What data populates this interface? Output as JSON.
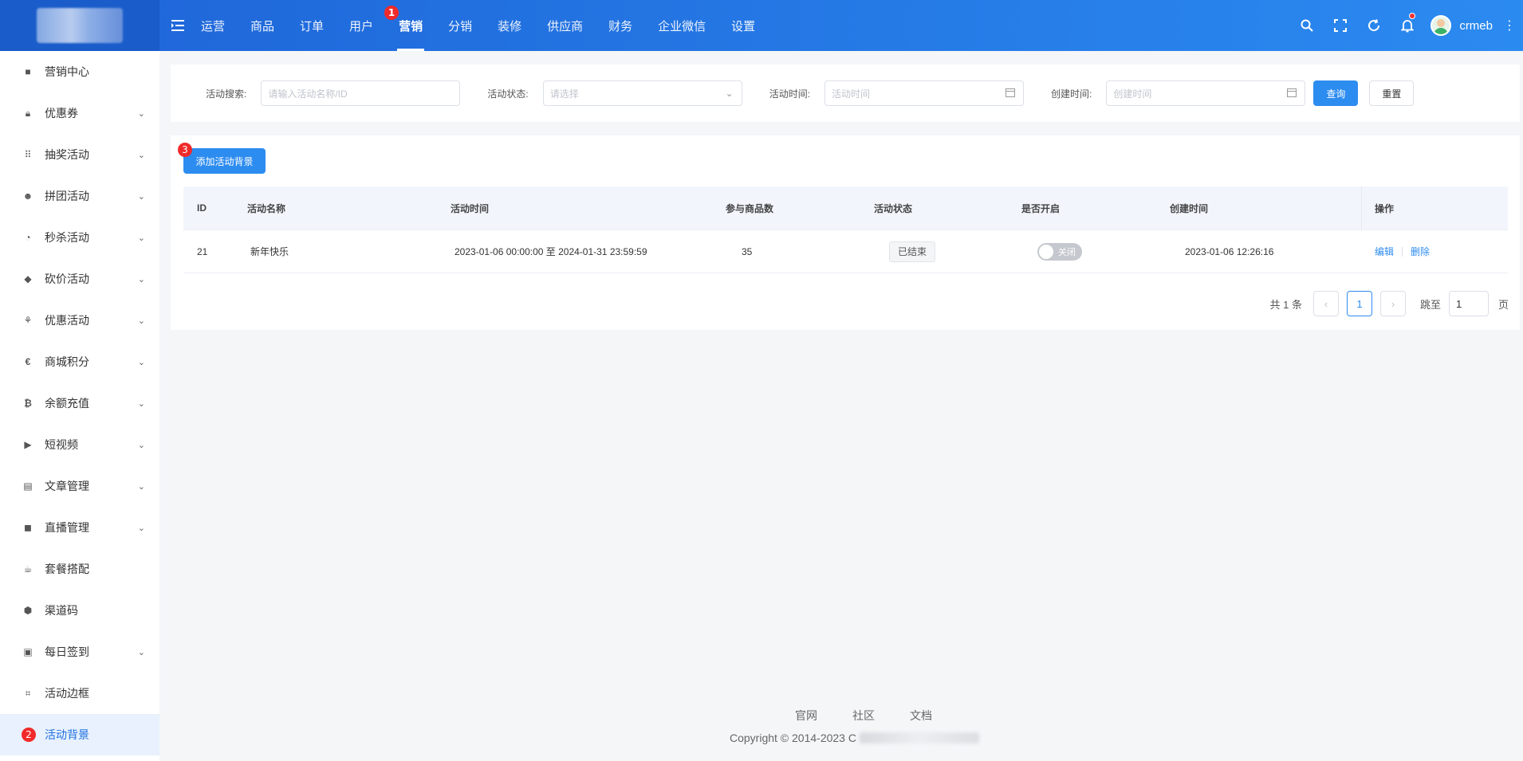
{
  "header": {
    "nav": [
      {
        "label": "运营"
      },
      {
        "label": "商品"
      },
      {
        "label": "订单"
      },
      {
        "label": "用户"
      },
      {
        "label": "营销"
      },
      {
        "label": "分销"
      },
      {
        "label": "装修"
      },
      {
        "label": "供应商"
      },
      {
        "label": "财务"
      },
      {
        "label": "企业微信"
      },
      {
        "label": "设置"
      }
    ],
    "active_nav": "营销",
    "user_name": "crmeb",
    "markers": [
      "1",
      "2",
      "3"
    ]
  },
  "sidebar": {
    "items": [
      {
        "label": "营销中心",
        "icon": "marketing-center-icon",
        "expandable": false
      },
      {
        "label": "优惠券",
        "icon": "lock-icon",
        "expandable": true
      },
      {
        "label": "抽奖活动",
        "icon": "grid-icon",
        "expandable": true
      },
      {
        "label": "拼团活动",
        "icon": "group-icon",
        "expandable": true
      },
      {
        "label": "秒杀活动",
        "icon": "clock-icon",
        "expandable": true
      },
      {
        "label": "砍价活动",
        "icon": "tag-icon",
        "expandable": true
      },
      {
        "label": "优惠活动",
        "icon": "discount-icon",
        "expandable": true
      },
      {
        "label": "商城积分",
        "icon": "euro-icon",
        "expandable": true
      },
      {
        "label": "余额充值",
        "icon": "bitcoin-icon",
        "expandable": true
      },
      {
        "label": "短视频",
        "icon": "video-icon",
        "expandable": true
      },
      {
        "label": "文章管理",
        "icon": "article-icon",
        "expandable": true
      },
      {
        "label": "直播管理",
        "icon": "camera-icon",
        "expandable": true
      },
      {
        "label": "套餐搭配",
        "icon": "cup-icon",
        "expandable": false
      },
      {
        "label": "渠道码",
        "icon": "cube-icon",
        "expandable": false
      },
      {
        "label": "每日签到",
        "icon": "calendar-icon",
        "expandable": true
      },
      {
        "label": "活动边框",
        "icon": "crop-icon",
        "expandable": false
      },
      {
        "label": "活动背景",
        "icon": "background-icon",
        "expandable": false,
        "active": true
      }
    ]
  },
  "filters": {
    "search_label": "活动搜索:",
    "search_placeholder": "请输入活动名称/ID",
    "status_label": "活动状态:",
    "status_placeholder": "请选择",
    "time_label": "活动时间:",
    "time_placeholder": "活动时间",
    "created_label": "创建时间:",
    "created_placeholder": "创建时间",
    "query_button": "查询",
    "reset_button": "重置"
  },
  "table": {
    "add_button": "添加活动背景",
    "columns": [
      "ID",
      "活动名称",
      "活动时间",
      "参与商品数",
      "活动状态",
      "是否开启",
      "创建时间",
      "操作"
    ],
    "rows": [
      {
        "id": "21",
        "name": "新年快乐",
        "time": "2023-01-06 00:00:00 至 2024-01-31 23:59:59",
        "product_count": "35",
        "status": "已结束",
        "enabled_label": "关闭",
        "enabled": false,
        "created": "2023-01-06 12:26:16",
        "edit": "编辑",
        "delete": "删除"
      }
    ]
  },
  "pagination": {
    "total_text": "共 1 条",
    "current_page": "1",
    "jump_label": "跳至",
    "jump_value": "1",
    "page_unit": "页"
  },
  "footer": {
    "links": [
      "官网",
      "社区",
      "文档"
    ],
    "copyright": "Copyright © 2014-2023 C"
  },
  "colors": {
    "primary": "#2d8cf0",
    "header_start": "#1e64d8",
    "header_end": "#2b8af0",
    "marker": "#f02a2a"
  }
}
